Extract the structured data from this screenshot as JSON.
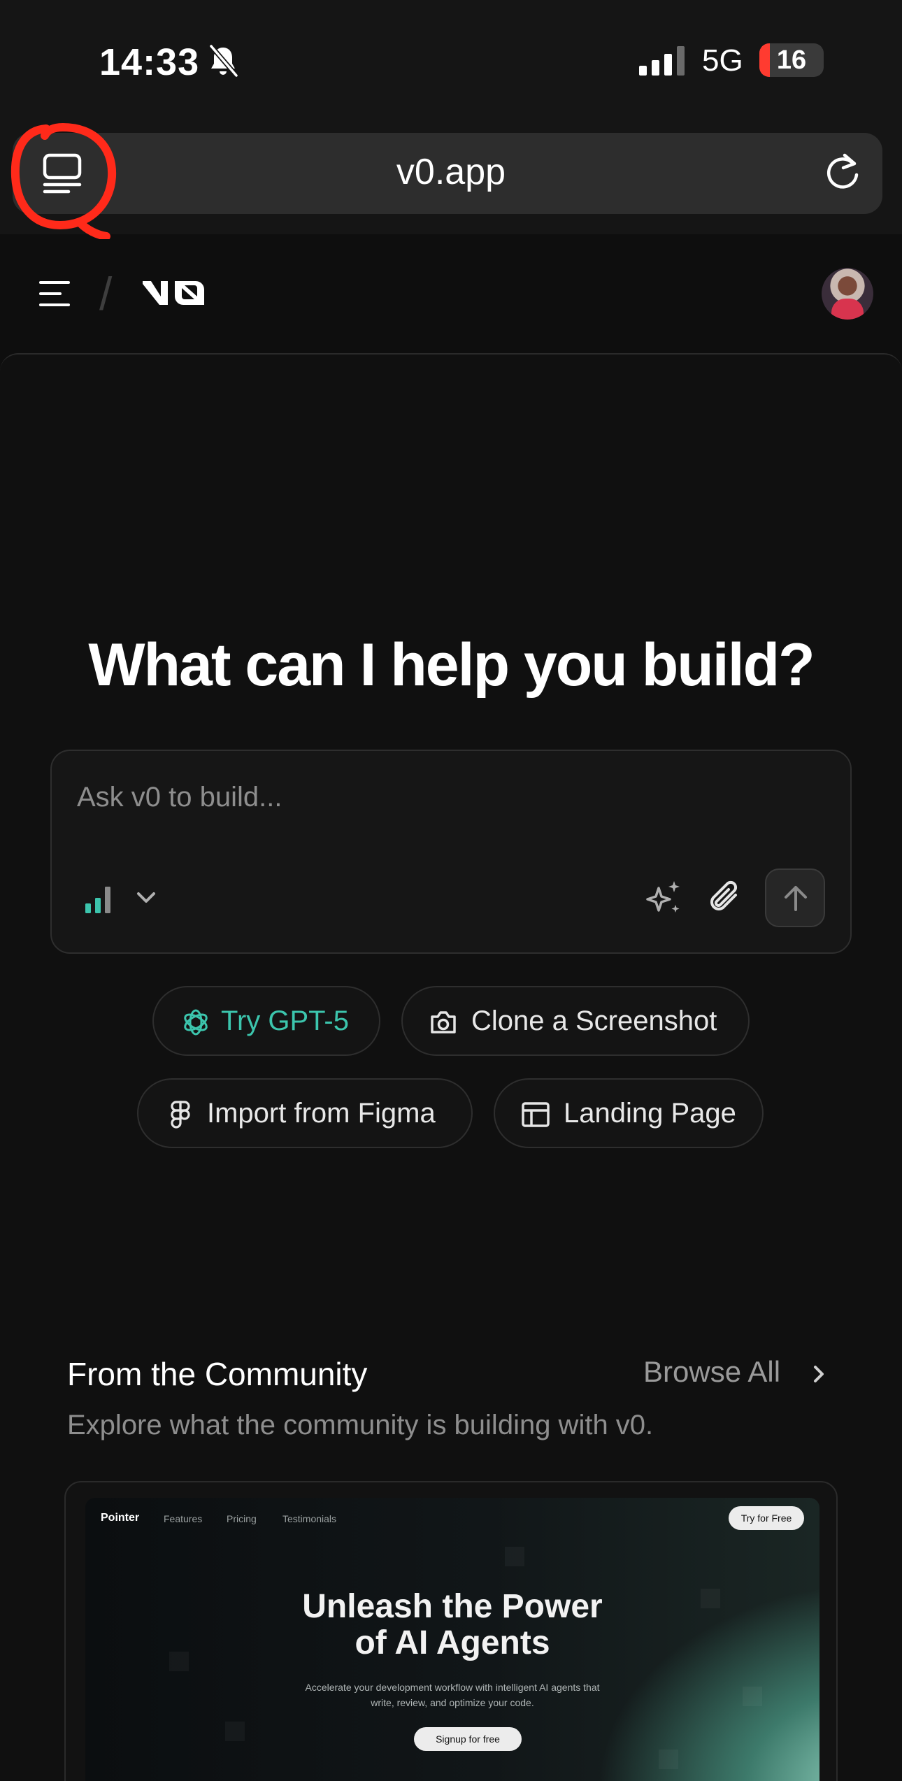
{
  "status_bar": {
    "time": "14:33",
    "network": "5G",
    "battery_level": "16",
    "battery_fraction": 0.16
  },
  "browser": {
    "url": "v0.app",
    "annotation_color": "#ff2a1a"
  },
  "app": {
    "breadcrumb_separator": "/",
    "logo_alt": "v0"
  },
  "hero": {
    "headline": "What can I help you build?",
    "prompt_placeholder": "Ask v0 to build..."
  },
  "chips": [
    {
      "label": "Try GPT-5",
      "icon": "openai-icon"
    },
    {
      "label": "Clone a Screenshot",
      "icon": "camera-icon"
    },
    {
      "label": "Import from Figma",
      "icon": "figma-icon"
    },
    {
      "label": "Landing Page",
      "icon": "layout-icon"
    }
  ],
  "community": {
    "title": "From the Community",
    "browse_all": "Browse All",
    "subtitle": "Explore what the community is building with v0."
  },
  "preview": {
    "brand": "Pointer",
    "nav": [
      "Features",
      "Pricing",
      "Testimonials"
    ],
    "cta": "Try for Free",
    "headline_line1": "Unleash the Power",
    "headline_line2": "of AI Agents",
    "subtitle": "Accelerate your development workflow with intelligent AI agents that write, review, and optimize your code.",
    "button": "Signup for free"
  },
  "colors": {
    "accent_teal": "#3cc5ad",
    "background": "#0e0e0e",
    "battery_low": "#ff3b30"
  }
}
